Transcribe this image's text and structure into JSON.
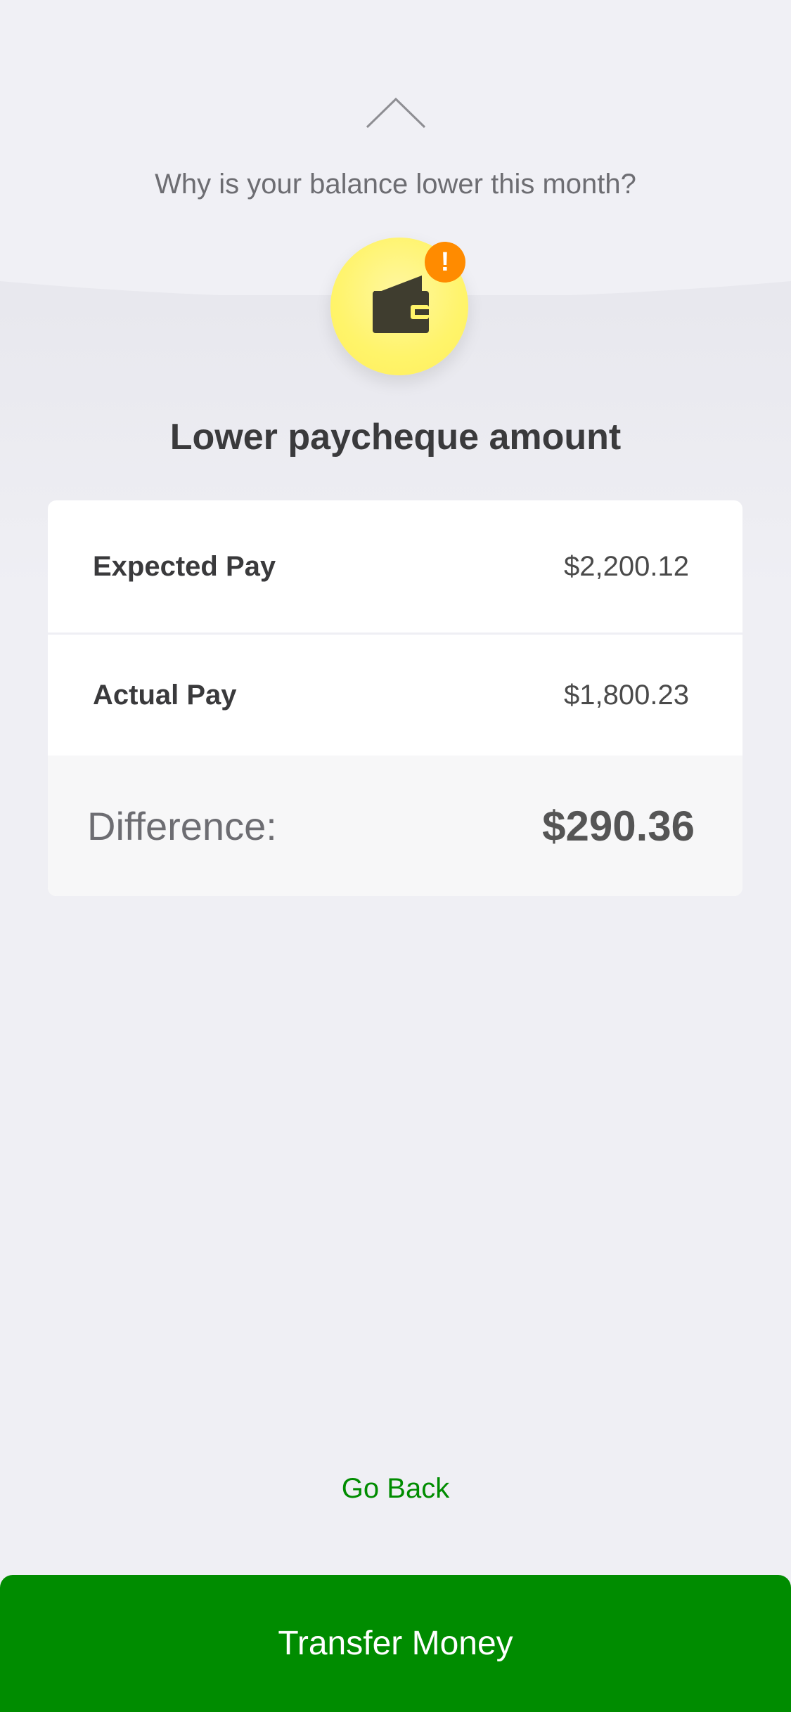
{
  "header": {
    "question": "Why is your balance lower this month?",
    "alert_badge": "!",
    "chevron_icon": "chevron-up-icon",
    "wallet_icon": "wallet-icon"
  },
  "card": {
    "title": "Lower paycheque amount",
    "rows": [
      {
        "label": "Expected Pay",
        "value": "$2,200.12"
      },
      {
        "label": "Actual Pay",
        "value": "$1,800.23"
      }
    ],
    "difference_label": "Difference:",
    "difference_value": "$290.36"
  },
  "actions": {
    "go_back": "Go Back",
    "transfer": "Transfer Money"
  },
  "colors": {
    "accent_green": "#008c00",
    "badge_orange": "#ff8b00",
    "wallet_yellow": "#fff46a"
  }
}
